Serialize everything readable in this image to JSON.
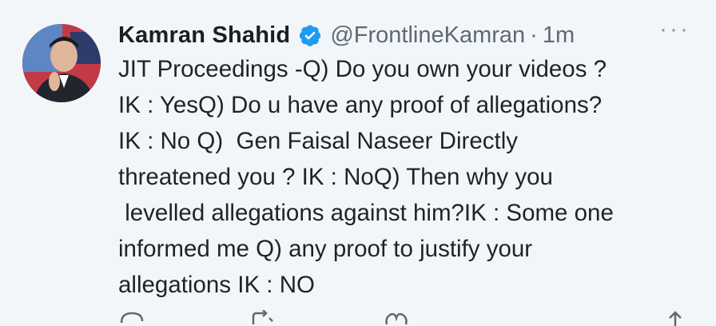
{
  "tweet": {
    "author_name": "Kamran Shahid",
    "handle": "@FrontlineKamran",
    "separator": "·",
    "time": "1m",
    "more": "···",
    "text_lines": [
      "JIT Proceedings -Q) Do you own your videos ?",
      "IK : YesQ) Do u have any proof of allegations?",
      "IK : No Q)  Gen Faisal Naseer Directly",
      "threatened you ? IK : NoQ) Then why you",
      " levelled allegations against him?IK : Some one",
      "informed me Q) any proof to justify your",
      "allegations IK : NO"
    ]
  },
  "icons": {
    "verified": "verified-badge-icon",
    "reply": "reply-icon",
    "retweet": "retweet-icon",
    "like": "like-icon",
    "share": "share-icon"
  },
  "colors": {
    "background": "#f3f6f9",
    "verified_blue": "#1d9bf0",
    "secondary_text": "#5d6a76"
  }
}
